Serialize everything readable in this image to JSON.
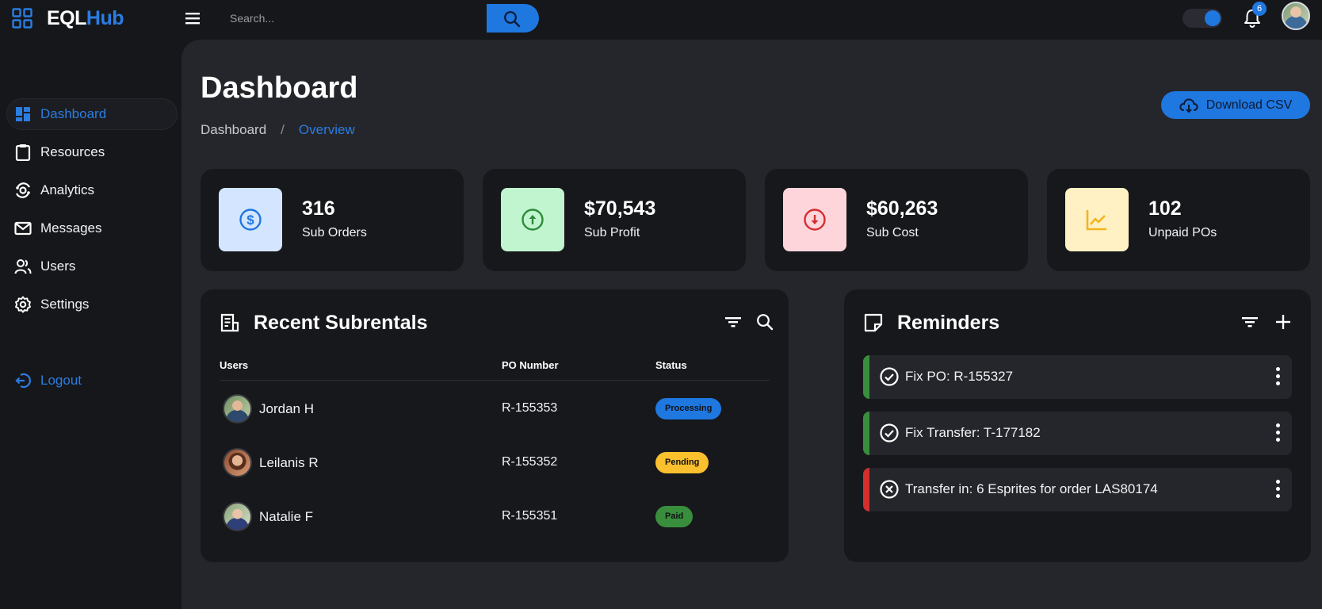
{
  "brand": {
    "prefix": "EQL",
    "suffix": "Hub",
    "accent": "#2a7de1"
  },
  "search": {
    "placeholder": "Search..."
  },
  "header": {
    "notification_count": "6",
    "theme_toggle_on": true
  },
  "sidebar": {
    "items": [
      {
        "label": "Dashboard",
        "icon": "dashboard-icon",
        "active": true
      },
      {
        "label": "Resources",
        "icon": "clipboard-icon"
      },
      {
        "label": "Analytics",
        "icon": "analytics-icon"
      },
      {
        "label": "Messages",
        "icon": "mail-icon"
      },
      {
        "label": "Users",
        "icon": "users-icon"
      },
      {
        "label": "Settings",
        "icon": "gear-icon"
      }
    ],
    "logout": "Logout"
  },
  "page": {
    "title": "Dashboard",
    "breadcrumb": [
      "Dashboard",
      "/",
      "Overview"
    ],
    "download_label": "Download CSV"
  },
  "stats": [
    {
      "value": "316",
      "label": "Sub Orders",
      "icon": "dollar-icon",
      "tile": "#d4e6ff",
      "color": "#1f77e0"
    },
    {
      "value": "$70,543",
      "label": "Sub Profit",
      "icon": "arrow-up-icon",
      "tile": "#c1f5d0",
      "color": "#2e8b3a"
    },
    {
      "value": "$60,263",
      "label": "Sub Cost",
      "icon": "arrow-down-icon",
      "tile": "#ffd5dc",
      "color": "#d32f2f"
    },
    {
      "value": "102",
      "label": "Unpaid POs",
      "icon": "chart-line-icon",
      "tile": "#fff1c4",
      "color": "#f2b41f"
    }
  ],
  "subrentals": {
    "title": "Recent Subrentals",
    "columns": [
      "Users",
      "PO Number",
      "Status"
    ],
    "rows": [
      {
        "user": "Jordan H",
        "po": "R-155353",
        "status": "Processing",
        "status_color": "#1f77e0"
      },
      {
        "user": "Leilanis R",
        "po": "R-155352",
        "status": "Pending",
        "status_color": "#fbc02d"
      },
      {
        "user": "Natalie F",
        "po": "R-155351",
        "status": "Paid",
        "status_color": "#388e3c"
      }
    ]
  },
  "reminders": {
    "title": "Reminders",
    "items": [
      {
        "text": "Fix PO: R-155327",
        "state": "done",
        "color": "#388e3c"
      },
      {
        "text": "Fix Transfer: T-177182",
        "state": "done",
        "color": "#388e3c"
      },
      {
        "text": "Transfer in: 6 Esprites for order LAS80174",
        "state": "failed",
        "color": "#d32f2f"
      }
    ]
  }
}
